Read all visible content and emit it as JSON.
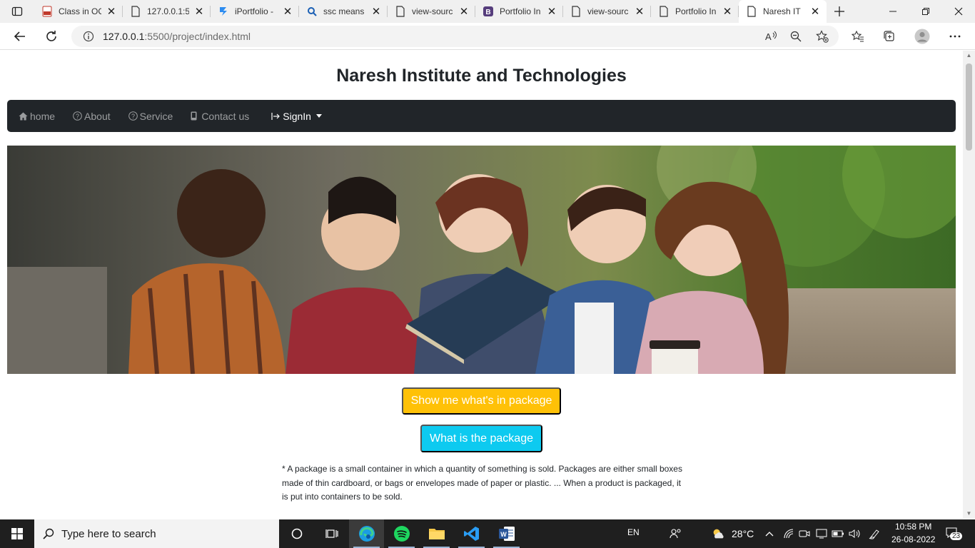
{
  "browser": {
    "tabs": [
      {
        "title": "Class in OO",
        "icon": "pdf-icon"
      },
      {
        "title": "127.0.0.1:5",
        "icon": "page-icon"
      },
      {
        "title": "iPortfolio -",
        "icon": "blue-logo-icon"
      },
      {
        "title": "ssc means",
        "icon": "search-icon"
      },
      {
        "title": "view-sourc",
        "icon": "page-icon"
      },
      {
        "title": "Portfolio In",
        "icon": "bootstrap-icon"
      },
      {
        "title": "view-sourc",
        "icon": "page-icon"
      },
      {
        "title": "Portfolio In",
        "icon": "page-icon"
      },
      {
        "title": "Naresh IT",
        "icon": "page-icon",
        "active": true
      }
    ],
    "url_host": "127.0.0.1",
    "url_path": ":5500/project/index.html"
  },
  "page": {
    "site_title": "Naresh Institute and Technologies",
    "nav": {
      "home": "home",
      "about": "About",
      "service": "Service",
      "contact": "Contact us",
      "signin": "SignIn"
    },
    "hero_alt": "Students reading a book together",
    "btn_package": "Show me what's in package",
    "btn_what": "What is the package",
    "package_text": "* A package is a small container in which a quantity of something is sold. Packages are either small boxes made of thin cardboard, or bags or envelopes made of paper or plastic. ... When a product is packaged, it is put into containers to be sold."
  },
  "taskbar": {
    "search_placeholder": "Type here to search",
    "language": "EN",
    "weather": "28°C",
    "time": "10:58 PM",
    "date": "26-08-2022",
    "notifications": "23"
  },
  "colors": {
    "navbar": "#212529",
    "warning": "#ffc107",
    "info": "#0dcaf0"
  }
}
